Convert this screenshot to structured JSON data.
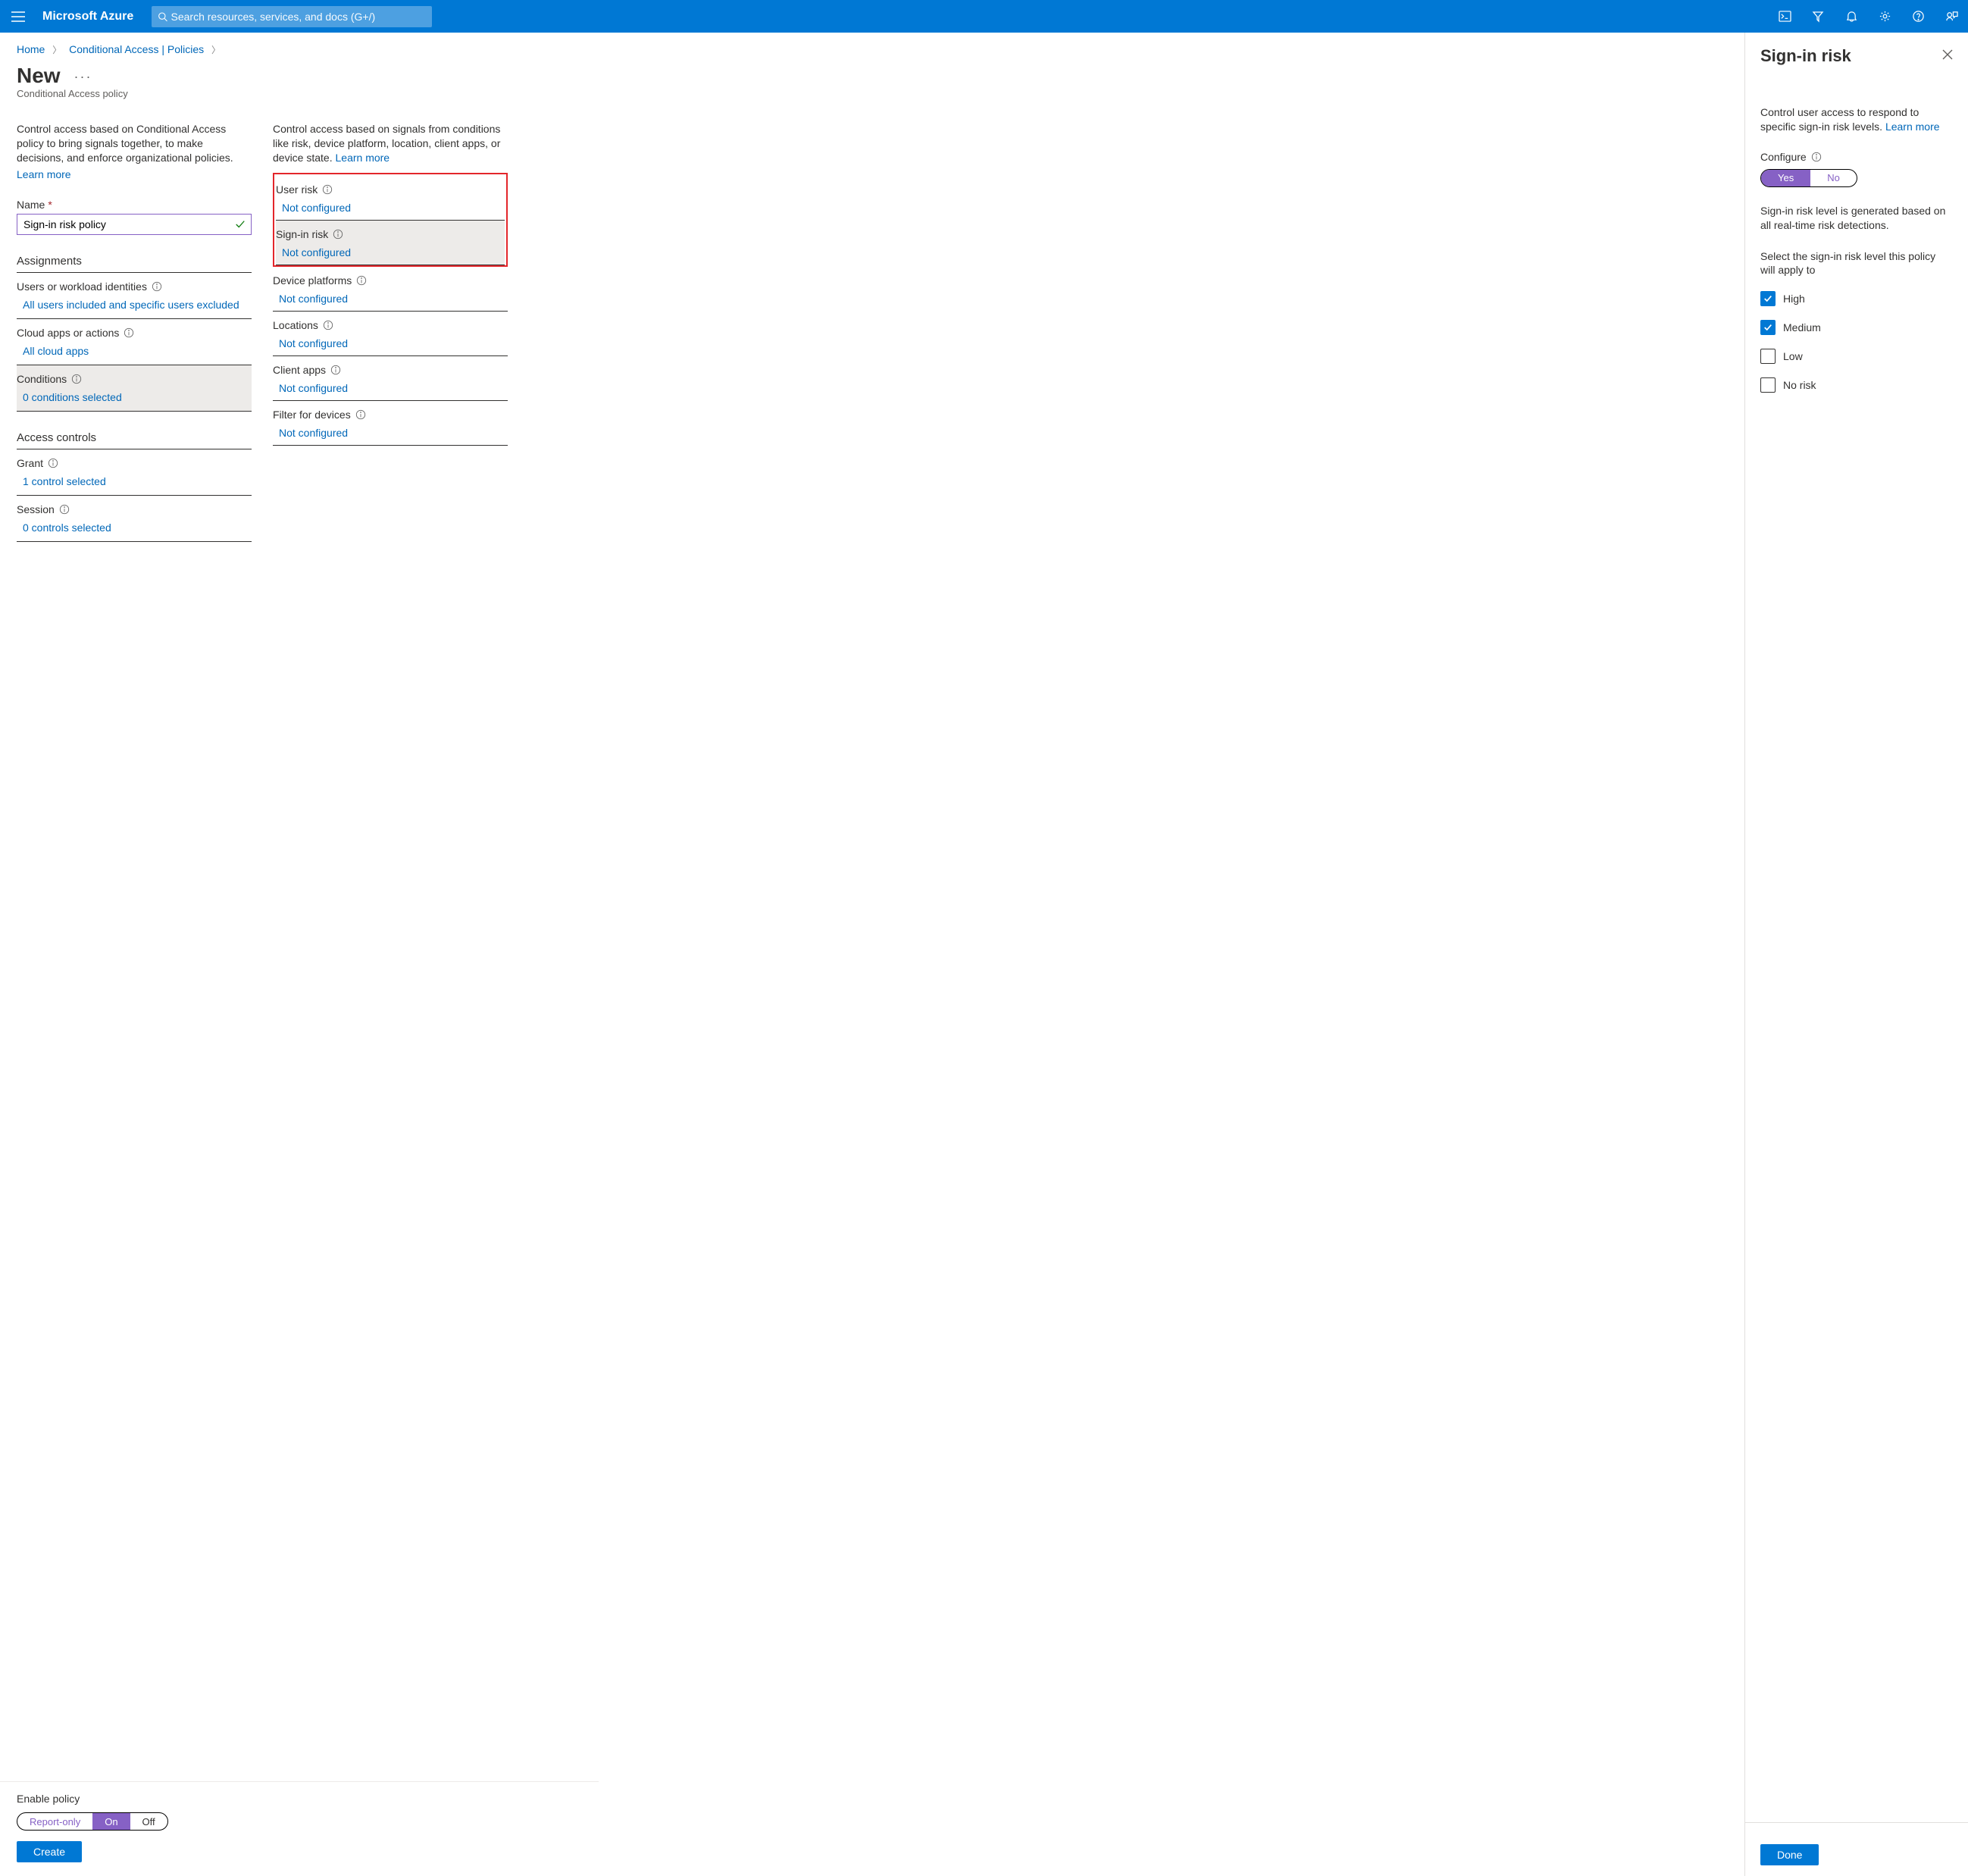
{
  "brand": "Microsoft Azure",
  "search_placeholder": "Search resources, services, and docs (G+/)",
  "crumbs": {
    "home": "Home",
    "ca": "Conditional Access | Policies"
  },
  "page": {
    "title": "New",
    "subtitle": "Conditional Access policy"
  },
  "leftBlurb": "Control access based on Conditional Access policy to bring signals together, to make decisions, and enforce organizational policies.",
  "learn_more": "Learn more",
  "nameLabel": "Name",
  "nameValue": "Sign-in risk policy",
  "sections": {
    "assignments": "Assignments",
    "access": "Access controls"
  },
  "assignRows": [
    {
      "title": "Users or workload identities",
      "value": "All users included and specific users excluded",
      "selected": false
    },
    {
      "title": "Cloud apps or actions",
      "value": "All cloud apps",
      "selected": false
    },
    {
      "title": "Conditions",
      "value": "0 conditions selected",
      "selected": true
    }
  ],
  "accessRows": [
    {
      "title": "Grant",
      "value": "1 control selected"
    },
    {
      "title": "Session",
      "value": "0 controls selected"
    }
  ],
  "rightBlurb": "Control access based on signals from conditions like risk, device platform, location, client apps, or device state.",
  "conds": [
    {
      "title": "User risk",
      "value": "Not configured",
      "selected": false
    },
    {
      "title": "Sign-in risk",
      "value": "Not configured",
      "selected": true
    },
    {
      "title": "Device platforms",
      "value": "Not configured",
      "selected": false
    },
    {
      "title": "Locations",
      "value": "Not configured",
      "selected": false
    },
    {
      "title": "Client apps",
      "value": "Not configured",
      "selected": false
    },
    {
      "title": "Filter for devices",
      "value": "Not configured",
      "selected": false
    }
  ],
  "enable": {
    "label": "Enable policy",
    "options": [
      "Report-only",
      "On",
      "Off"
    ],
    "active": "On"
  },
  "createBtn": "Create",
  "panel": {
    "title": "Sign-in risk",
    "desc": "Control user access to respond to specific sign-in risk levels.",
    "configure": "Configure",
    "yes": "Yes",
    "no": "No",
    "note1": "Sign-in risk level is generated based on all real-time risk detections.",
    "note2": "Select the sign-in risk level this policy will apply to",
    "levels": [
      {
        "label": "High",
        "checked": true
      },
      {
        "label": "Medium",
        "checked": true
      },
      {
        "label": "Low",
        "checked": false
      },
      {
        "label": "No risk",
        "checked": false
      }
    ],
    "done": "Done"
  }
}
